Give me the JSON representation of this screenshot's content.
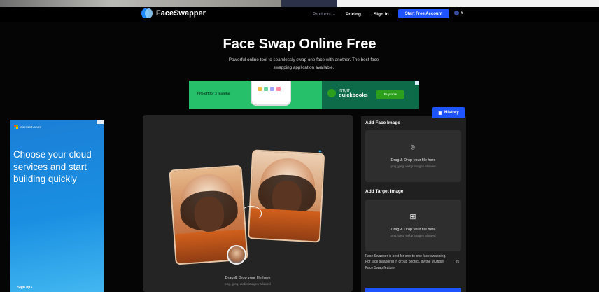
{
  "nav": {
    "logo_text": "FaceSwapper",
    "products": "Products",
    "pricing": "Pricing",
    "signin": "Sign In",
    "cta": "Start Free Account",
    "lang": "6"
  },
  "hero": {
    "title": "Face Swap Online Free",
    "subtitle": "Powerful online tool to seamlessly swap one face with another. The best face swapping application available."
  },
  "ad_top": {
    "offer": "70% off for 3 months",
    "brand_small": "INTUIT",
    "brand": "quickbooks",
    "button": "Buy now"
  },
  "ad_left": {
    "brand": "Microsoft Azure",
    "headline": "Choose your cloud services and start building quickly",
    "signup": "Sign up ›"
  },
  "editor": {
    "drop_title": "Drag & Drop your file here",
    "drop_sub": "png, jpeg, webp images allowed"
  },
  "panel": {
    "history": "History",
    "face_label": "Add Face Image",
    "target_label": "Add Target Image",
    "dz_title": "Drag & Drop your file here",
    "dz_sub": "png, jpeg, webp images allowed",
    "note": "Face Swapper is best for one-to-one face swapping. For face swapping in group photos, try the Multiple Face Swap feature."
  },
  "colors": {
    "accent": "#1d54ff",
    "background": "#050505",
    "panel": "#202020"
  },
  "icons": [
    "facebook-circle-logo-icon",
    "chevron-down-icon",
    "globe-icon",
    "history-icon",
    "face-scan-icon",
    "image-add-icon",
    "refresh-icon",
    "sparkle-icon"
  ]
}
